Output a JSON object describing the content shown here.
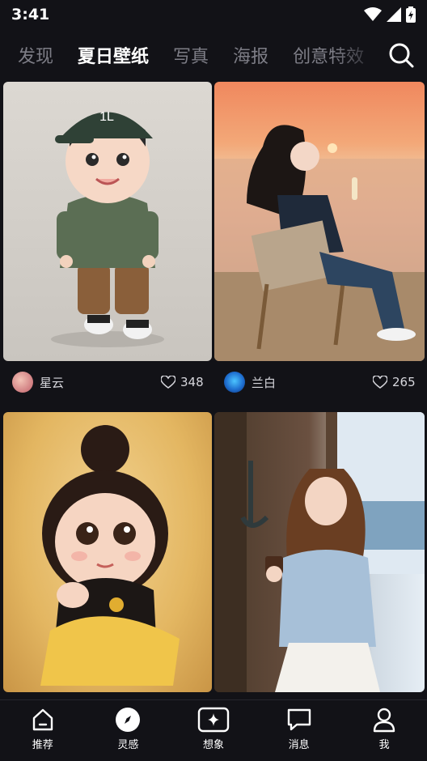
{
  "status": {
    "time": "3:41"
  },
  "tabs": [
    {
      "label": "发现",
      "active": false
    },
    {
      "label": "夏日壁纸",
      "active": true
    },
    {
      "label": "写真",
      "active": false
    },
    {
      "label": "海报",
      "active": false
    },
    {
      "label": "创意特效",
      "active": false
    }
  ],
  "feed": [
    {
      "author": "星云",
      "likes": "348",
      "image": "cartoon-boy-green-cap"
    },
    {
      "author": "兰白",
      "likes": "265",
      "image": "woman-beach-chair-sunset"
    },
    {
      "image": "cartoon-girl-bun-yellow"
    },
    {
      "image": "woman-coffee-window-sea"
    }
  ],
  "nav": [
    {
      "label": "推荐",
      "icon": "home-icon"
    },
    {
      "label": "灵感",
      "icon": "compass-icon",
      "active": true
    },
    {
      "label": "想象",
      "icon": "sparkle-icon"
    },
    {
      "label": "消息",
      "icon": "message-icon"
    },
    {
      "label": "我",
      "icon": "profile-icon"
    }
  ]
}
